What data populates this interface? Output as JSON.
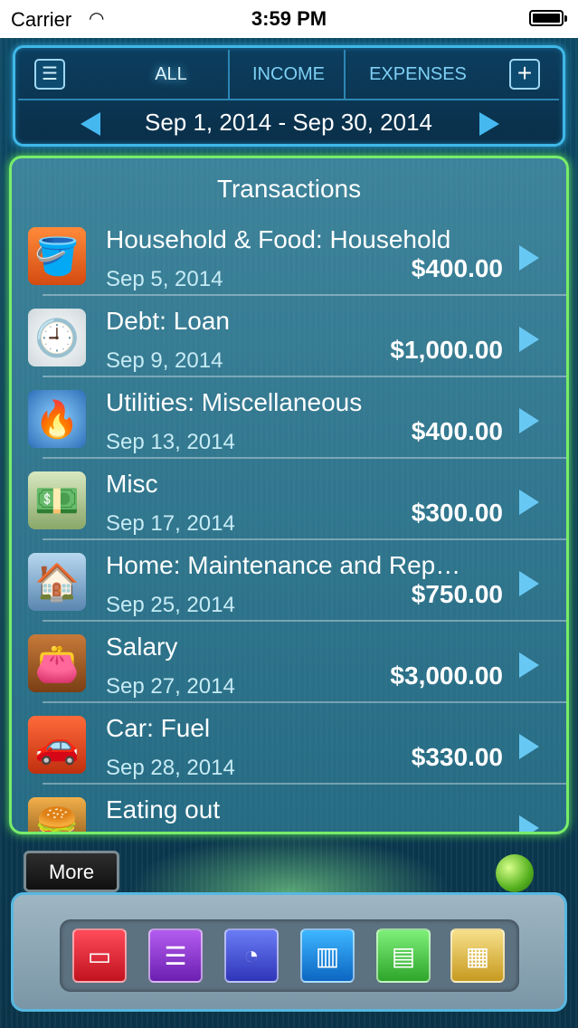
{
  "status": {
    "carrier": "Carrier",
    "time": "3:59 PM"
  },
  "header": {
    "tabs": [
      "ALL",
      "INCOME",
      "EXPENSES"
    ],
    "date_range": "Sep 1, 2014 - Sep 30, 2014"
  },
  "panel": {
    "title": "Transactions"
  },
  "transactions": [
    {
      "title": "Household & Food: Household",
      "date": "Sep 5, 2014",
      "amount": "$400.00",
      "icon": "bucket-icon"
    },
    {
      "title": "Debt: Loan",
      "date": "Sep 9, 2014",
      "amount": "$1,000.00",
      "icon": "clock-money-icon"
    },
    {
      "title": "Utilities: Miscellaneous",
      "date": "Sep 13, 2014",
      "amount": "$400.00",
      "icon": "gas-burner-icon"
    },
    {
      "title": "Misc",
      "date": "Sep 17, 2014",
      "amount": "$300.00",
      "icon": "money-stack-icon"
    },
    {
      "title": "Home: Maintenance and Rep…",
      "date": "Sep 25, 2014",
      "amount": "$750.00",
      "icon": "house-icon"
    },
    {
      "title": "Salary",
      "date": "Sep 27, 2014",
      "amount": "$3,000.00",
      "icon": "wallet-icon"
    },
    {
      "title": "Car: Fuel",
      "date": "Sep 28, 2014",
      "amount": "$330.00",
      "icon": "car-icon"
    },
    {
      "title": "Eating out",
      "date": "",
      "amount": "",
      "icon": "burger-icon"
    }
  ],
  "footer": {
    "more_label": "More",
    "toolbar_icons": [
      "battery-icon",
      "gantt-icon",
      "pie-icon",
      "bar-chart-icon",
      "list-icon",
      "report-icon"
    ]
  }
}
